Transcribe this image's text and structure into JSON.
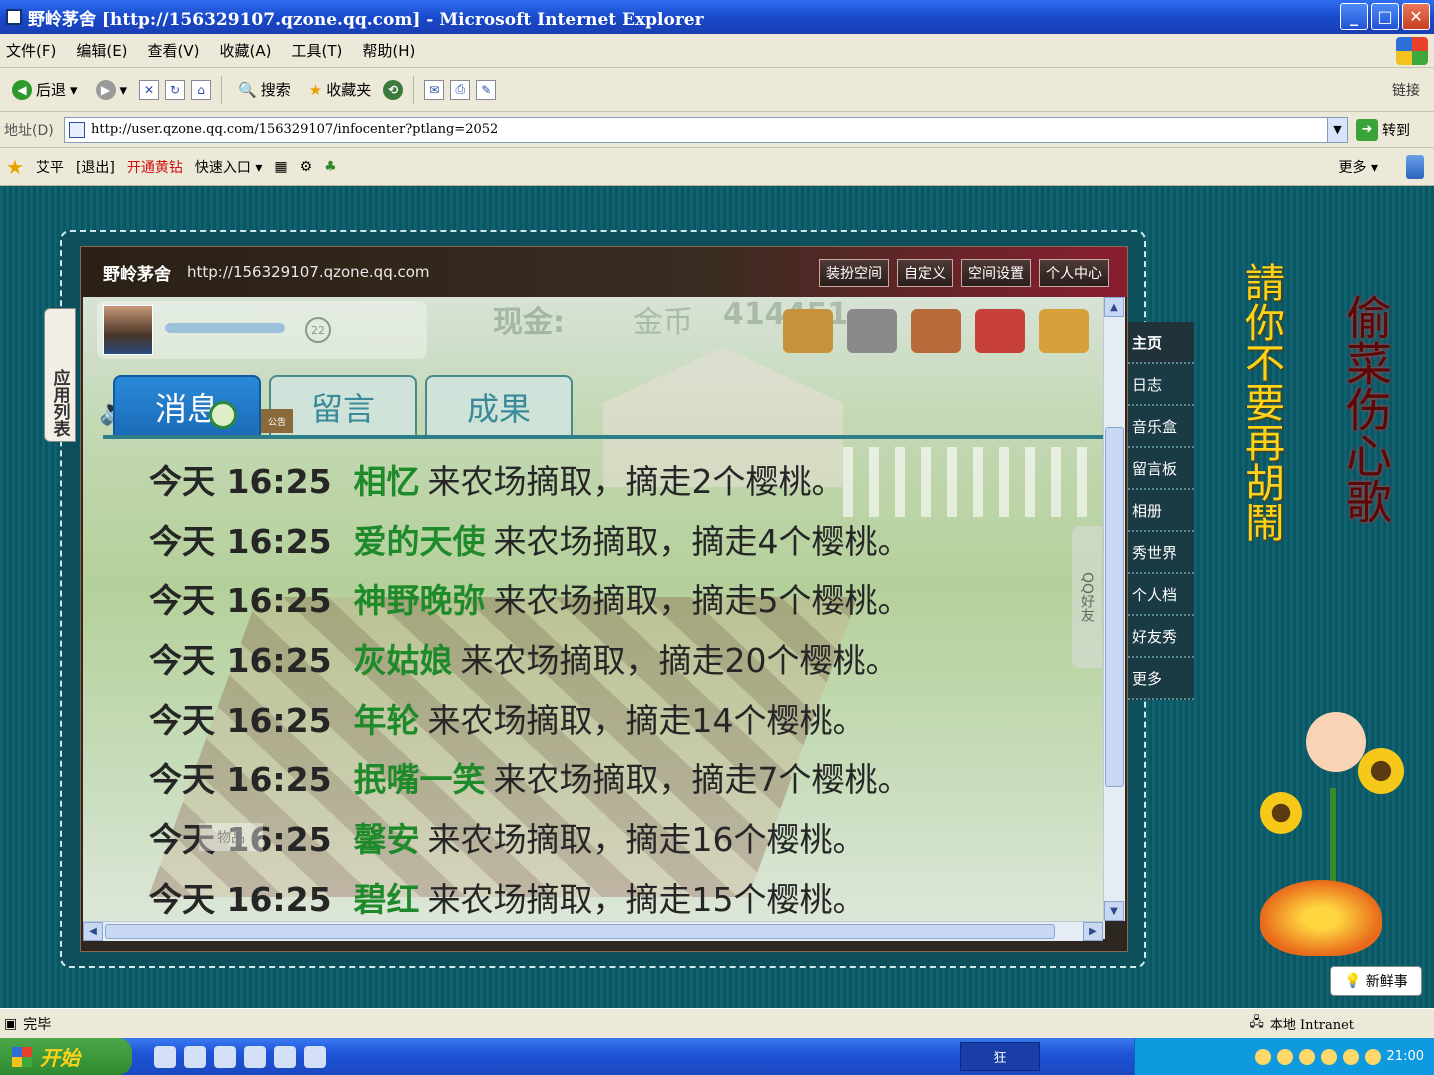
{
  "window": {
    "title": "野岭茅舍 [http://156329107.qzone.qq.com] - Microsoft Internet Explorer",
    "buttons": {
      "minimize": "_",
      "maximize": "□",
      "close": "✕"
    }
  },
  "menu": [
    "文件(F)",
    "编辑(E)",
    "查看(V)",
    "收藏(A)",
    "工具(T)",
    "帮助(H)"
  ],
  "toolbar": {
    "back": "后退",
    "search": "搜索",
    "favorites": "收藏夹",
    "links": "链接"
  },
  "address": {
    "label": "地址(D)",
    "url": "http://user.qzone.qq.com/156329107/infocenter?ptlang=2052",
    "go": "转到"
  },
  "qqbar": {
    "user": "艾平",
    "logout": "[退出]",
    "open_yellow": "开通黄钻",
    "quick_entry": "快速入口",
    "more": "更多"
  },
  "qzone": {
    "space_name": "野岭茅舍",
    "space_url": "http://156329107.qzone.qq.com",
    "top_links": [
      "装扮空间",
      "自定义",
      "空间设置",
      "个人中心"
    ],
    "side_nav": [
      "主页",
      "日志",
      "音乐盒",
      "留言板",
      "相册",
      "秀世界",
      "个人档",
      "好友秀",
      "更多"
    ],
    "app_list_tab": "应用列表",
    "qq_friends_tab": "QQ好友"
  },
  "farm": {
    "cash_label": "现金:",
    "coin_label": "金币",
    "coin_value": "414451",
    "level": "22",
    "product_tab": "物品",
    "notice_label": "公告",
    "tabs": [
      "消息",
      "留言",
      "成果"
    ],
    "active_tab": "消息",
    "log": [
      {
        "time": "今天 16:25",
        "who": "相忆",
        "action": "来农场摘取，摘走2个樱桃。"
      },
      {
        "time": "今天 16:25",
        "who": "爱的天使",
        "action": "来农场摘取，摘走4个樱桃。"
      },
      {
        "time": "今天 16:25",
        "who": "神野晚弥",
        "action": "来农场摘取，摘走5个樱桃。"
      },
      {
        "time": "今天 16:25",
        "who": "灰姑娘",
        "action": "来农场摘取，摘走20个樱桃。"
      },
      {
        "time": "今天 16:25",
        "who": "年轮",
        "action": "来农场摘取，摘走14个樱桃。"
      },
      {
        "time": "今天 16:25",
        "who": "抿嘴一笑",
        "action": "来农场摘取，摘走7个樱桃。"
      },
      {
        "time": "今天 16:25",
        "who": "馨安",
        "action": "来农场摘取，摘走16个樱桃。"
      },
      {
        "time": "今天 16:25",
        "who": "碧红",
        "action": "来农场摘取，摘走15个樱桃。"
      }
    ]
  },
  "decor": {
    "poem_yellow": "請你不要再胡鬧",
    "poem_red": "偷菜伤心歌",
    "news_button": "新鲜事"
  },
  "status": {
    "text": "完毕",
    "zone": "本地 Intranet"
  },
  "taskbar": {
    "start": "开始",
    "task": "狂",
    "clock": "21:00"
  },
  "colors": {
    "accent_green": "#1e8a2a",
    "title_blue": "#1847c8",
    "page_teal": "#0d5a68"
  }
}
